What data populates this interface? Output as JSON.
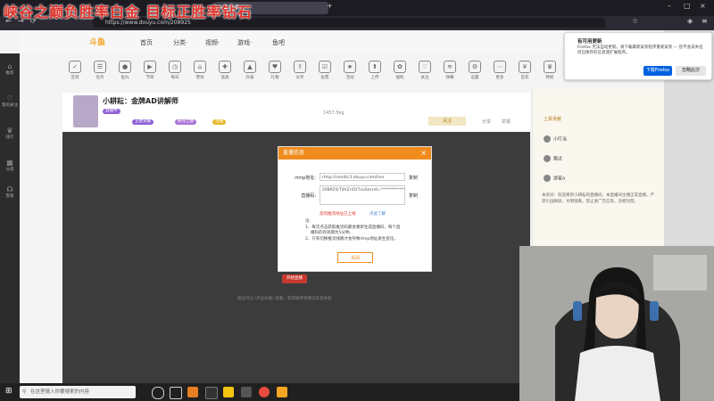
{
  "overlay": {
    "title": "峡谷之巅负胜率白金  目标正胜率钻石"
  },
  "browser": {
    "url": "https://www.douyu.com/208925",
    "tab_label": "斗鱼直播"
  },
  "header": {
    "logo": "斗鱼",
    "nav": [
      "首页",
      "分类·",
      "视频·",
      "游戏·",
      "鱼吧"
    ]
  },
  "sidebar": {
    "items": [
      "推荐",
      "我的关注",
      "排行",
      "分类",
      "客服"
    ]
  },
  "tools": [
    "签到",
    "任务",
    "鱼丸",
    "节目",
    "每日",
    "营地",
    "道具",
    "升级",
    "礼物",
    "分享",
    "投票",
    "活动",
    "上传",
    "福利",
    "关注",
    "弹幕",
    "设置",
    "更多",
    "首充",
    "特权"
  ],
  "streamer": {
    "name": "小耕耘：金牌AD讲解师",
    "rank": "11",
    "badge1": "排行",
    "tag_live": "直播中",
    "tag_a": "王者荣耀",
    "tag_b": "峡谷之巅",
    "tag_c": "主播",
    "report": "举报",
    "share": "分享",
    "follow_btn": "关注",
    "follow_count": "1457.5kg"
  },
  "modal": {
    "title": "直播信息",
    "close_x": "×",
    "rtmp_label": "rtmp地址:",
    "rtmp_value": "rtmp://sendtc3.douyu.com/live",
    "code_label": "直播码:",
    "code_value": "208925rT4hZr41f7xxSecret=**************",
    "copy1": "复制",
    "copy2": "复制",
    "warn": "您的推流地址已上线",
    "learn_more": "点此了解",
    "note_head": "注:",
    "note1": "1、每次点击获取推流码都会重新生成直播码，每个直",
    "note1b": "播码的有效期为5分钟。",
    "note2": "2、只有切换推流线路才会导致rtmp地址发生变化。",
    "close_btn": "关闭"
  },
  "player": {
    "bottom_text": "粉丝可以 (点击升级) 观看，获得钱帝将建议答案体验",
    "btn": "开始直播"
  },
  "notification": {
    "title": "有可用更新",
    "body": "Firefox 无法自动更新。请下载最新安装程序重新安装 — 您不会丢失任何已保存的信息或扩展程序。",
    "btn_primary": "下载Firefox",
    "btn_secondary": "忽略此次"
  },
  "chat": {
    "tab": "土豪贡献",
    "rows": [
      "小叮当",
      "路过",
      "游客a"
    ],
    "notice": "本房间：欢迎来到小耕耘的直播间，本直播间主播正常直播，严禁引战刷屏，文明观看，禁止发广告信息，违者封禁。"
  },
  "taskbar": {
    "search_placeholder": "在这里输入你要搜索的内容"
  },
  "colors": {
    "accent": "#f08c1e",
    "overlay_red": "#e0322b"
  }
}
